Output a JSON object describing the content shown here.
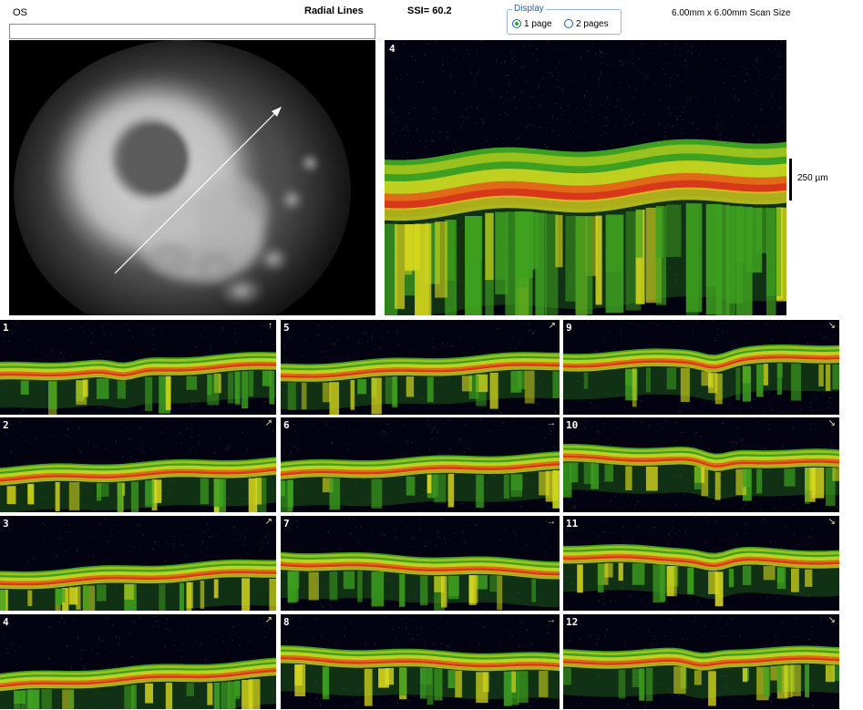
{
  "header": {
    "eye": "OS",
    "scan_type": "Radial Lines",
    "ssi": "SSI= 60.2",
    "scan_size": "6.00mm x 6.00mm Scan Size",
    "display": {
      "legend": "Display",
      "options": [
        {
          "label": "1 page",
          "checked": true
        },
        {
          "label": "2 pages",
          "checked": false
        }
      ]
    }
  },
  "main_scan": {
    "number": "4",
    "scale_label": "250 µm"
  },
  "thumbnails": [
    {
      "number": "1",
      "arrow": "↑"
    },
    {
      "number": "2",
      "arrow": "↗"
    },
    {
      "number": "3",
      "arrow": "↗"
    },
    {
      "number": "4",
      "arrow": "↗"
    },
    {
      "number": "5",
      "arrow": "↗"
    },
    {
      "number": "6",
      "arrow": "→"
    },
    {
      "number": "7",
      "arrow": "→"
    },
    {
      "number": "8",
      "arrow": "→"
    },
    {
      "number": "9",
      "arrow": "↘"
    },
    {
      "number": "10",
      "arrow": "↘"
    },
    {
      "number": "11",
      "arrow": "↘"
    },
    {
      "number": "12",
      "arrow": "↘"
    }
  ],
  "colors": {
    "retina_green": "#3ea020",
    "retina_yellow": "#d7d81e",
    "retina_orange": "#e06a18",
    "retina_red": "#d8381a",
    "scan_background": "#020210",
    "accent_blue": "#2a5fa8"
  }
}
